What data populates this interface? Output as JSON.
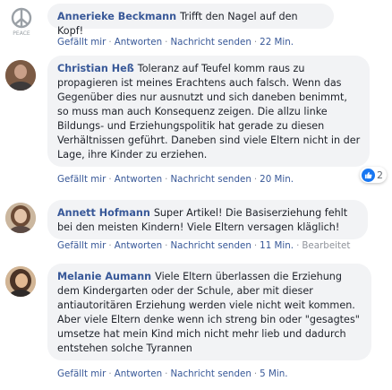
{
  "comments": [
    {
      "author": "Annerieke Beckmann",
      "text": "Trifft den Nagel auf den Kopf!",
      "avatar": "peace-sign-avatar",
      "actions": {
        "like": "Gefällt mir",
        "reply": "Antworten",
        "message": "Nachricht senden",
        "time": "22 Min."
      }
    },
    {
      "author": "Christian Heß",
      "text": "Toleranz auf Teufel komm raus zu propagieren ist meines Erachtens auch falsch. Wenn das Gegenüber dies nur ausnutzt und sich daneben benimmt, so muss man auch Konsequenz zeigen. Die allzu linke Bildungs- und Erziehungspolitik hat gerade zu diesen Verhältnissen geführt. Daneben sind viele Eltern nicht in der Lage, ihre Kinder zu erziehen.",
      "avatar": "man-avatar",
      "reaction_count": "2",
      "actions": {
        "like": "Gefällt mir",
        "reply": "Antworten",
        "message": "Nachricht senden",
        "time": "20 Min."
      }
    },
    {
      "author": "Annett Hofmann",
      "text": "Super Artikel! Die Basiserziehung fehlt bei den meisten Kindern! Viele Eltern versagen kläglich!",
      "avatar": "woman-avatar",
      "actions": {
        "like": "Gefällt mir",
        "reply": "Antworten",
        "message": "Nachricht senden",
        "time": "11 Min.",
        "edited": "Bearbeitet"
      }
    },
    {
      "author": "Melanie Aumann",
      "text": "Viele Eltern überlassen die Erziehung dem Kindergarten oder der Schule, aber mit dieser antiautoritären Erziehung werden viele nicht weit kommen. Aber viele Eltern denke wenn ich streng bin oder \"gesagtes\" umsetze hat mein Kind mich nicht mehr lieb und dadurch entstehen solche Tyrannen",
      "avatar": "woman-avatar",
      "actions": {
        "like": "Gefällt mir",
        "reply": "Antworten",
        "message": "Nachricht senden",
        "time": "5 Min."
      }
    }
  ],
  "colors": {
    "link": "#385898",
    "bubble": "#f2f3f5",
    "like_blue": "#1877f2"
  }
}
